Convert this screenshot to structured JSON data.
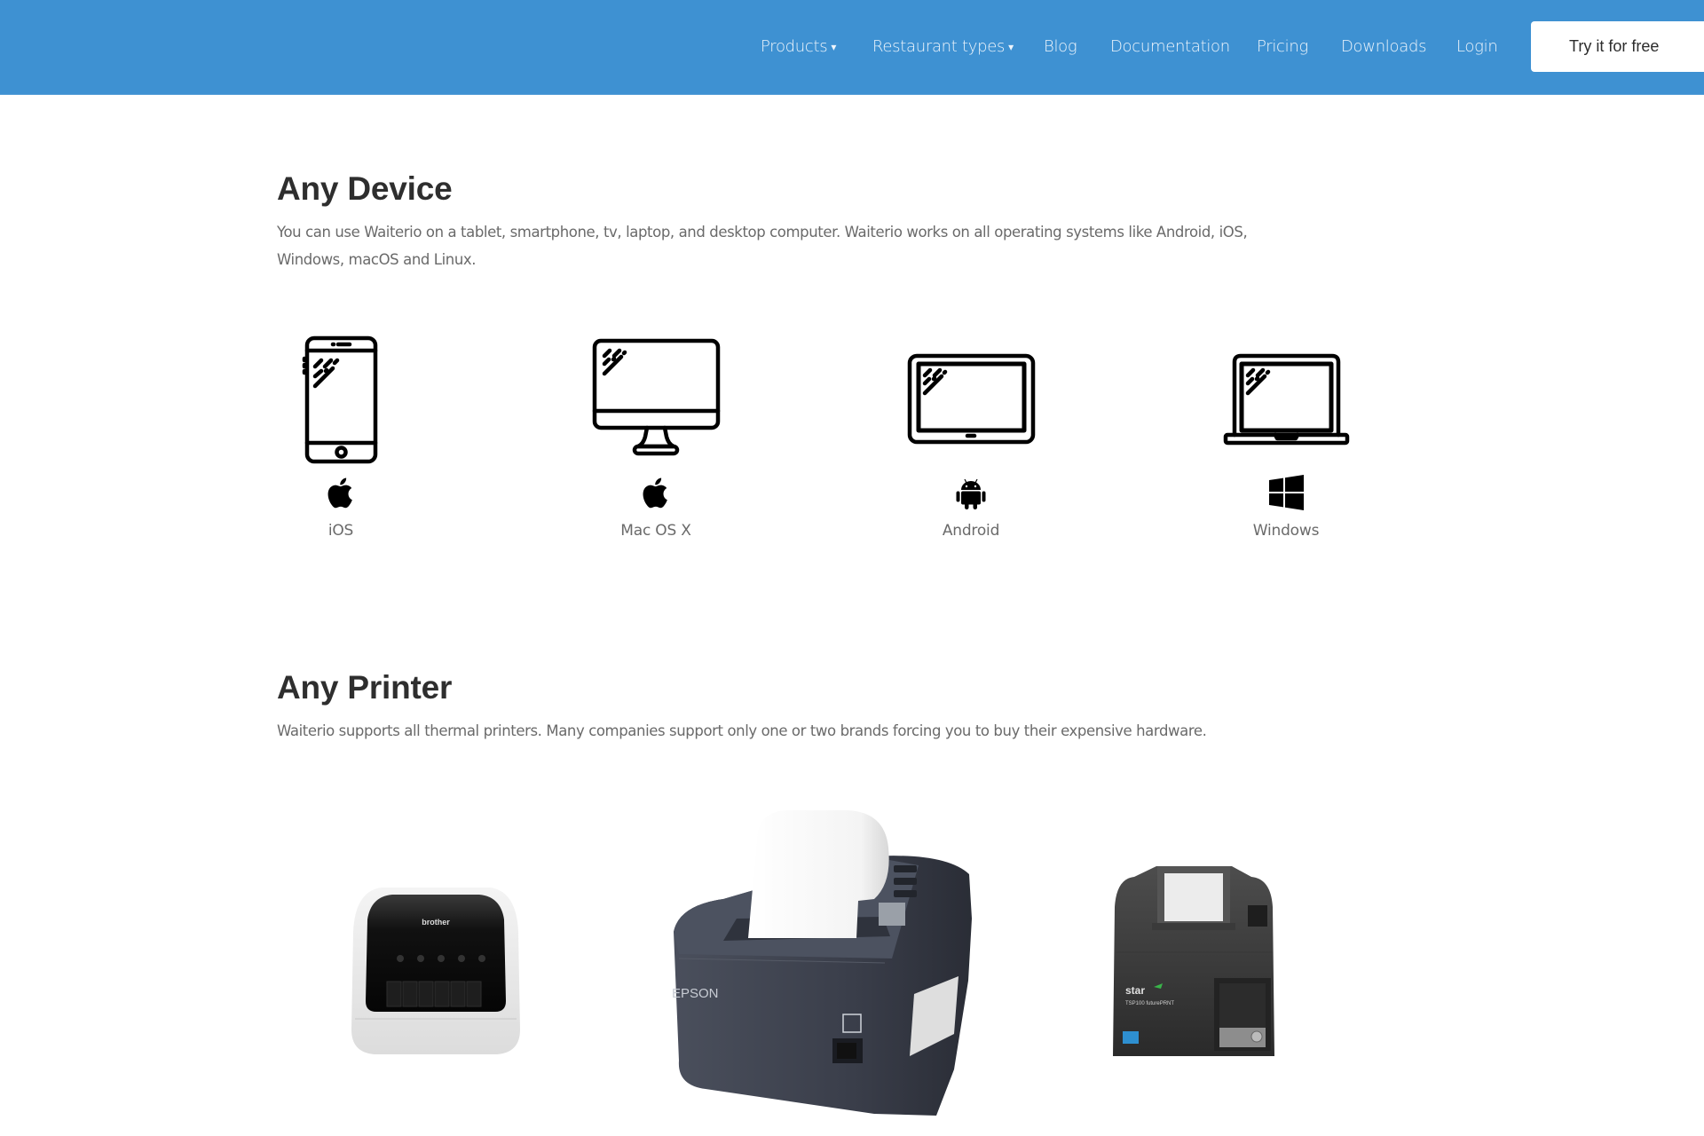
{
  "header": {
    "background_color": "#3e91d2",
    "nav": [
      {
        "label": "Products",
        "has_dropdown": true,
        "caret": "▾"
      },
      {
        "label": "Restaurant types",
        "has_dropdown": true,
        "caret": "▾"
      },
      {
        "label": "Blog",
        "has_dropdown": false
      },
      {
        "label": "Documentation",
        "has_dropdown": false
      },
      {
        "label": "Pricing",
        "has_dropdown": false
      },
      {
        "label": "Downloads",
        "has_dropdown": false
      },
      {
        "label": "Login",
        "has_dropdown": false
      }
    ],
    "cta_label": "Try it for free"
  },
  "any_device": {
    "title": "Any Device",
    "text": "You can use Waiterio on a tablet, smartphone, tv, laptop, and desktop computer. Waiterio works on all operating systems like Android, iOS, Windows, macOS and Linux.",
    "devices": [
      {
        "device_icon": "smartphone-icon",
        "os_icon": "apple-icon",
        "label": "iOS"
      },
      {
        "device_icon": "desktop-monitor-icon",
        "os_icon": "apple-icon",
        "label": "Mac OS X"
      },
      {
        "device_icon": "tablet-icon",
        "os_icon": "android-icon",
        "label": "Android"
      },
      {
        "device_icon": "laptop-icon",
        "os_icon": "windows-icon",
        "label": "Windows"
      }
    ]
  },
  "any_printer": {
    "title": "Any Printer",
    "text": "Waiterio supports all thermal printers. Many companies support only one or two brands forcing you to buy their expensive hardware.",
    "printers": [
      {
        "brand": "brother",
        "name": "brother-label-printer"
      },
      {
        "brand": "EPSON",
        "name": "epson-receipt-printer"
      },
      {
        "brand": "star",
        "model_text": "TSP100 futurePRNT",
        "name": "star-receipt-printer"
      }
    ]
  }
}
